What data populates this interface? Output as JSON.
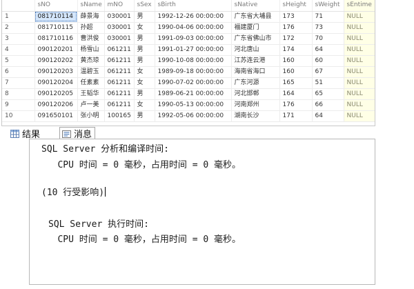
{
  "grid": {
    "columns": [
      "",
      "sNO",
      "sName",
      "mNO",
      "sSex",
      "sBirth",
      "sNative",
      "sHeight",
      "sWeight",
      "sEntime"
    ],
    "rows": [
      [
        "1",
        "081710114",
        "薛景海",
        "030001",
        "男",
        "1992-12-26 00:00:00",
        "广东省大埔县",
        "173",
        "71",
        "NULL"
      ],
      [
        "2",
        "081710115",
        "孙超",
        "030001",
        "女",
        "1990-04-06 00:00:00",
        "福建厦门",
        "176",
        "73",
        "NULL"
      ],
      [
        "3",
        "081710116",
        "曹洪俊",
        "030001",
        "男",
        "1991-09-03 00:00:00",
        "广东省佛山市",
        "172",
        "70",
        "NULL"
      ],
      [
        "4",
        "090120201",
        "杨雪山",
        "061211",
        "男",
        "1991-01-27 00:00:00",
        "河北唐山",
        "174",
        "64",
        "NULL"
      ],
      [
        "5",
        "090120202",
        "黄杰琼",
        "061211",
        "男",
        "1990-10-08 00:00:00",
        "江苏连云港",
        "160",
        "60",
        "NULL"
      ],
      [
        "6",
        "090120203",
        "温碧玉",
        "061211",
        "女",
        "1989-09-18 00:00:00",
        "海南省海口",
        "160",
        "67",
        "NULL"
      ],
      [
        "7",
        "090120204",
        "任素素",
        "061211",
        "女",
        "1990-07-02 00:00:00",
        "广东河源",
        "165",
        "51",
        "NULL"
      ],
      [
        "8",
        "090120205",
        "王韬华",
        "061211",
        "男",
        "1989-06-21 00:00:00",
        "河北邯郸",
        "164",
        "65",
        "NULL"
      ],
      [
        "9",
        "090120206",
        "卢一美",
        "061211",
        "女",
        "1990-05-13 00:00:00",
        "河南郑州",
        "176",
        "66",
        "NULL"
      ],
      [
        "10",
        "091650101",
        "张小明",
        "100165",
        "男",
        "1992-05-06 00:00:00",
        "湖南长沙",
        "171",
        "64",
        "NULL"
      ]
    ]
  },
  "tabs": {
    "results_label": "结果",
    "messages_label": "消息",
    "results_icon": "grid-icon",
    "messages_icon": "message-icon"
  },
  "messages": {
    "line1": "SQL Server 分析和编译时间:",
    "line2": "   CPU 时间 = 0 毫秒，占用时间 = 0 毫秒。",
    "line3": "(10 行受影响)",
    "line4": "SQL Server 执行时间:",
    "line5": "   CPU 时间 = 0 毫秒，占用时间 = 0 毫秒。"
  },
  "colors": {
    "selected_cell": "#d4e6fb",
    "null_cell": "#ffffe6"
  }
}
